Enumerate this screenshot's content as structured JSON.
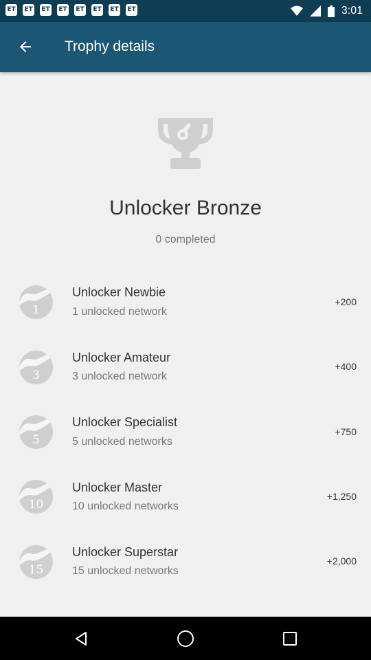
{
  "status_bar": {
    "carrier_badges": [
      "ET",
      "ET",
      "ET",
      "ET",
      "ET",
      "ET",
      "ET",
      "ET"
    ],
    "time": "3:01"
  },
  "app_bar": {
    "title": "Trophy details"
  },
  "trophy": {
    "name": "Unlocker Bronze",
    "completed": "0 completed"
  },
  "levels": [
    {
      "badge": "1",
      "title": "Unlocker Newbie",
      "subtitle": "1 unlocked network",
      "points": "+200"
    },
    {
      "badge": "3",
      "title": "Unlocker Amateur",
      "subtitle": "3 unlocked network",
      "points": "+400"
    },
    {
      "badge": "5",
      "title": "Unlocker Specialist",
      "subtitle": "5 unlocked networks",
      "points": "+750"
    },
    {
      "badge": "10",
      "title": "Unlocker Master",
      "subtitle": "10 unlocked networks",
      "points": "+1,250"
    },
    {
      "badge": "15",
      "title": "Unlocker Superstar",
      "subtitle": "15 unlocked networks",
      "points": "+2,000"
    }
  ],
  "colors": {
    "status_bar": "#0f3d54",
    "app_bar": "#1b5674",
    "badge": "#cfcfcf",
    "background": "#f0f0f0"
  }
}
